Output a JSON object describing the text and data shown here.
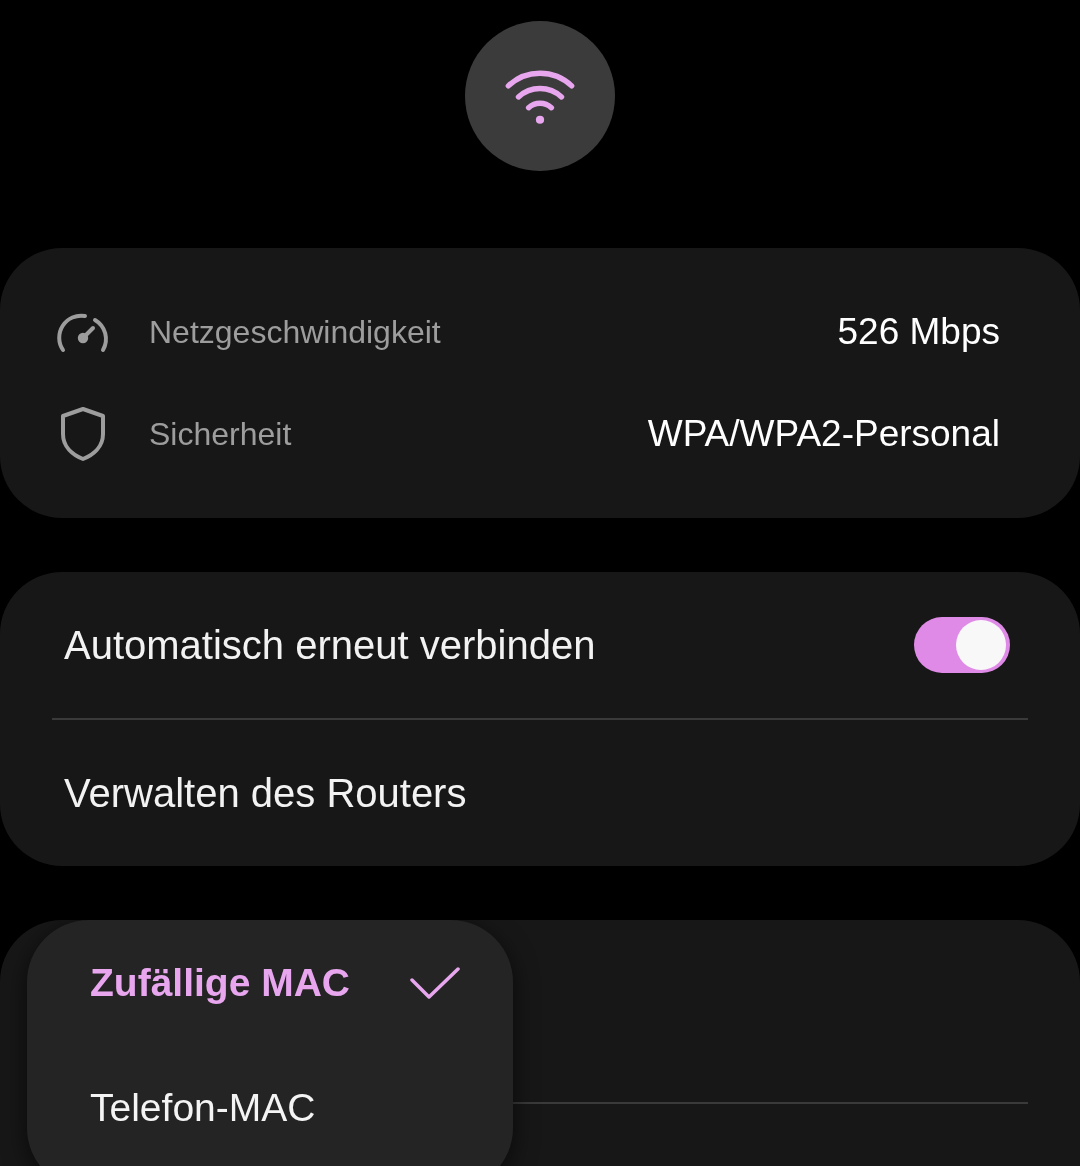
{
  "details": [
    {
      "kind": "speed",
      "label": "Netzgeschwindigkeit",
      "value": "526 Mbps"
    },
    {
      "kind": "security",
      "label": "Sicherheit",
      "value": "WPA/WPA2-Personal"
    }
  ],
  "settings": [
    {
      "kind": "toggle",
      "label": "Automatisch erneut verbinden",
      "on": true
    },
    {
      "kind": "link",
      "label": "Verwalten des Routers"
    }
  ],
  "mac_menu": {
    "options": [
      {
        "label": "Zufällige MAC",
        "selected": true
      },
      {
        "label": "Telefon-MAC",
        "selected": false
      }
    ]
  }
}
